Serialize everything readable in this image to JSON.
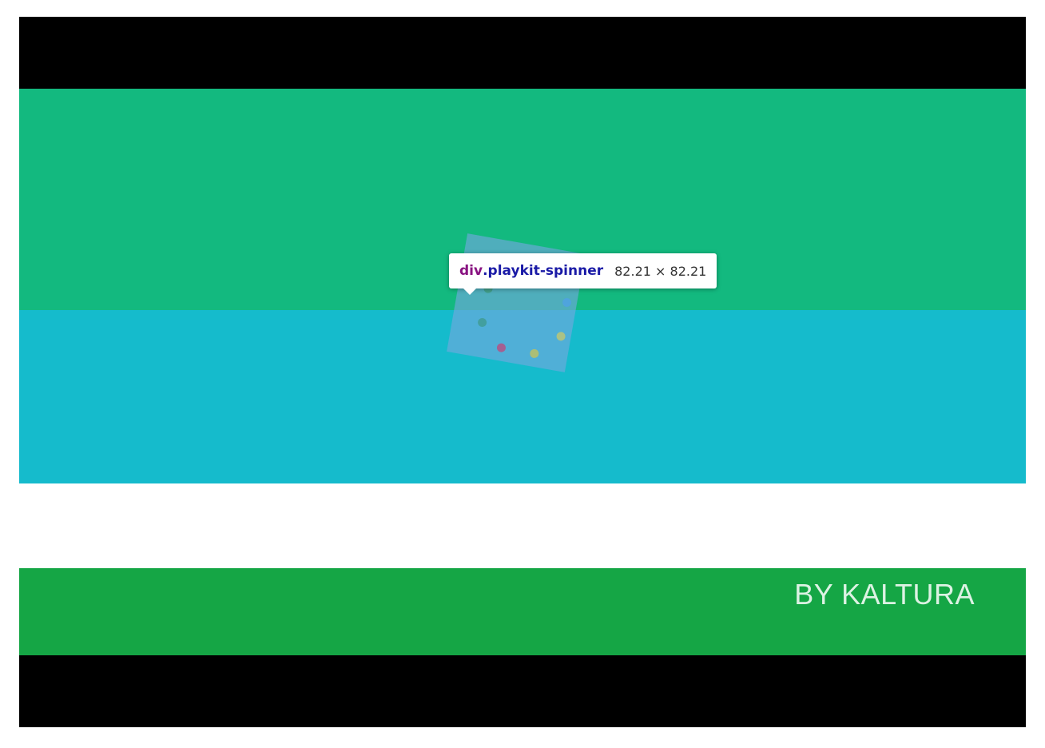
{
  "video": {
    "colors": {
      "top_green": "#13b97f",
      "teal": "#15bbcc",
      "white": "#ffffff",
      "bottom_green": "#15a645",
      "letterbox": "#000000"
    },
    "watermark": "BY KALTURA"
  },
  "spinner": {
    "highlight_color": "#6fa8dc",
    "dot_colors": [
      "#c79a7e",
      "#4d6fd6",
      "#4fa0e8",
      "#c8c86a",
      "#c9c356",
      "#c0457a",
      "#3d9a8c",
      "#3d9a7a"
    ]
  },
  "inspect_tooltip": {
    "tag": "div",
    "class_selector": ".playkit-spinner",
    "dimensions": "82.21 × 82.21"
  }
}
